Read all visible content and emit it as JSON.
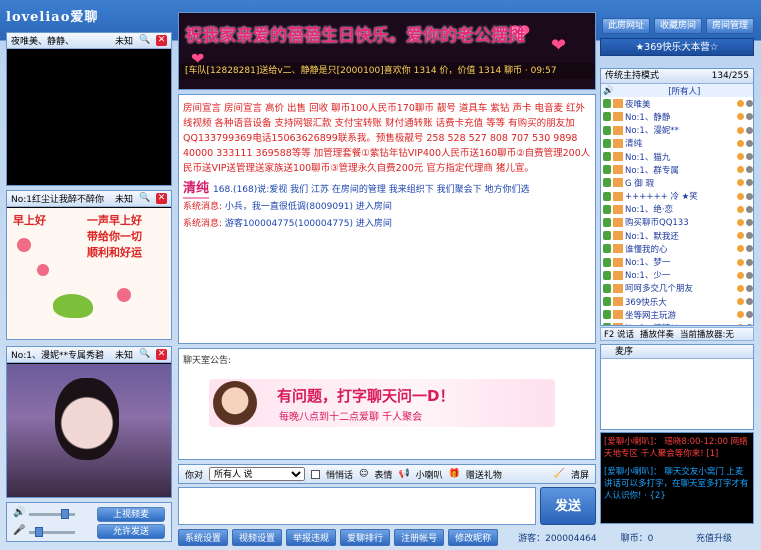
{
  "app": {
    "logo_latin": "loveliao",
    "logo_cn": "爱聊"
  },
  "videos": [
    {
      "name": "夜唯美、静静、",
      "status": "未知"
    },
    {
      "name": "No:1红尘让我醉不醉你",
      "status": "未知",
      "caption1": "早上好",
      "caption2": "一声早上好",
      "caption3": "带给你一切",
      "caption4": "顺利和好运"
    },
    {
      "name": "No:1、漫妮**专属秀碧",
      "status": "未知"
    }
  ],
  "controls": {
    "btn1": "上视频麦",
    "btn2": "允许发送"
  },
  "banner": {
    "message": "祝我家亲爱的蓓蓓生日快乐。爱你的老公摆摊",
    "ticker": "[车队[12828281]送给v二、静静是只[2000100]喜欢你 1314 价，价值 1314 聊币 · 09:57"
  },
  "chat": {
    "notice_red": "房间宣言 房间宣言 高价 出售 回收 聊币100人民币170聊币 靓号 道具车 紫钻 声卡 电音麦 红外线视频 各种语音设备 支持网银汇款 支付宝转账 财付通转账 话费卡充值 等等 有购买的朋友加QQ133799369电话15063626899联系我。预售极靓号 258 528 527 808 707 530 9898 40000 333111 369588等等 加管理套餐①紫钻年钻VIP400人民币送160聊币②自费管理200人民币送VIP送管理送家族送100聊币③管理永久自费200元 官方指定代理商 猪儿宣。",
    "name_tag": "清纯",
    "line1": "168.(168)说:爱视 我们 江苏 在房间的管理 我来组织下 我们聚会下 地方你们选",
    "sys_label": "系统消息:",
    "sys1": "小兵，我一直很低调(8009091) 进入房间",
    "sys2": "游客100004775(100004775) 进入房间"
  },
  "notice_panel": {
    "title": "聊天室公告:",
    "ad_line1": "有问题，打字聊天问一D！",
    "ad_line2": "每晚八点到十二点爱聊 千人聚会"
  },
  "inputbar": {
    "to_label": "你对",
    "to_value": "所有人 说",
    "whisper": "悄悄话",
    "emoji": "表情",
    "horn": "小喇叭",
    "gift": "赠送礼物",
    "clear": "清屏"
  },
  "send_label": "发送",
  "bottom": {
    "buttons": [
      "系统设置",
      "视频设置",
      "举报违规",
      "爱聊排行",
      "注册帐号",
      "修改昵称"
    ],
    "guest": "游客：200004464",
    "coins": "聊币：0",
    "upgrade": "充值升级"
  },
  "right": {
    "top_buttons": [
      "此房网址",
      "收藏房间",
      "房间管理"
    ],
    "room_name": "★369快乐大本营☆",
    "list_mode": "传统主持模式",
    "count": "134/255",
    "everyone": "[所有人]",
    "users": [
      "夜唯美",
      "No:1、静静",
      "No:1、漫妮**",
      "清纯",
      "No:1、猫九",
      "No:1、群专属",
      "G 御 瑕",
      "++++++ 冷 ★笑",
      "No:1、绝·恋",
      "购买聊币QQ133",
      "No:1、默我还",
      "谁懂我的心",
      "No:1、梦一",
      "No:1、少一",
      "呵呵多交几个朋友",
      "369快乐大",
      "坐等网主玩游",
      "No:1、糖糖**"
    ],
    "fbar_say": "F2 说话",
    "fbar_pos": "播放伴奏",
    "fbar_cur": "当前播放器:无",
    "queue_title": "麦序",
    "broadcast1": "[爱聊小喇叭]： 瑶晓8:00-12:00 网络天地专区 千人聚会等你来! [1]",
    "broadcast2": "[爱聊小喇叭]： 聊天交友小窝门 上麦讲话可以多打字，在聊天室多打字才有人认识你! · {2}"
  }
}
